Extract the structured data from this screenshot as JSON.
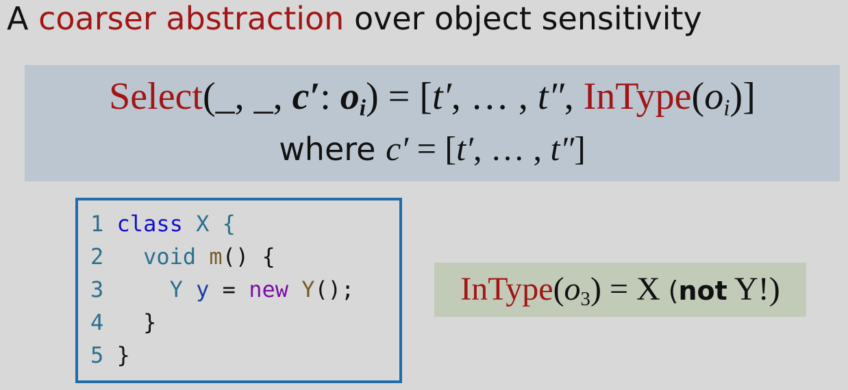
{
  "title": {
    "prefix": "A ",
    "accent": "coarser abstraction",
    "suffix": " over object sensitivity"
  },
  "formula": {
    "select": "Select",
    "open_args": "(_, _, ",
    "c_prime": "c′",
    "colon": ": ",
    "o": "o",
    "i": "i",
    "eq_list": ") = [",
    "t1": "t′",
    "dots": ", … , ",
    "t2": "t″",
    "comma": ", ",
    "intype": "InType",
    "paren_open": "(",
    "o2": "o",
    "i2": "i",
    "close": ")]",
    "where": "where ",
    "where_c": "c′",
    "where_eq": " = [",
    "where_t1": "t′",
    "where_dots": ", … , ",
    "where_t2": "t″",
    "where_close": "]"
  },
  "code": {
    "lines": [
      {
        "num": "1",
        "indent": " ",
        "tokens": [
          "class",
          " X {"
        ]
      },
      {
        "num": "2",
        "indent": "   ",
        "tokens": [
          "void",
          " ",
          "m",
          "() {"
        ]
      },
      {
        "num": "3",
        "indent": "     ",
        "tokens": [
          "Y",
          " ",
          "y",
          " = ",
          "new",
          " ",
          "Y",
          "();"
        ]
      },
      {
        "num": "4",
        "indent": "   ",
        "tokens": [
          "}"
        ]
      },
      {
        "num": "5",
        "indent": " ",
        "tokens": [
          "}"
        ]
      }
    ]
  },
  "intype_note": {
    "intype": "InType",
    "paren_open": "(",
    "o": "o",
    "sub": "3",
    "eq": ") = X ",
    "paren_note_open": "(",
    "not": "not",
    "paren_note_rest": " Y!)"
  },
  "colors": {
    "accent": "#a31515",
    "formula_bg": "#bcc6d0",
    "note_bg": "#c2cab8",
    "code_border": "#1f6cad"
  }
}
